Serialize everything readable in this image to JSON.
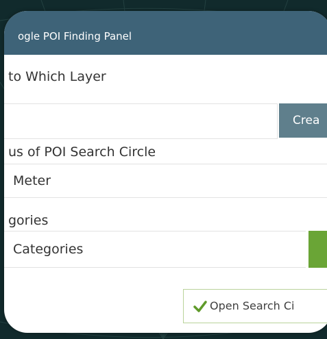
{
  "panel": {
    "title": "ogle POI Finding Panel"
  },
  "layer_section": {
    "label": "to Which Layer",
    "input_value": "",
    "create_button_label": "Crea"
  },
  "radius_section": {
    "label": "us of POI Search Circle",
    "select_value": "Meter"
  },
  "categories_section": {
    "label": "gories",
    "select_value": "Categories"
  },
  "open_button": {
    "label": "Open Search Ci",
    "icon": "checkmark-icon"
  },
  "colors": {
    "titlebar": "#3e6378",
    "create_button": "#5f7f8c",
    "accent_green": "#6aa536",
    "background": "#112a2c"
  }
}
